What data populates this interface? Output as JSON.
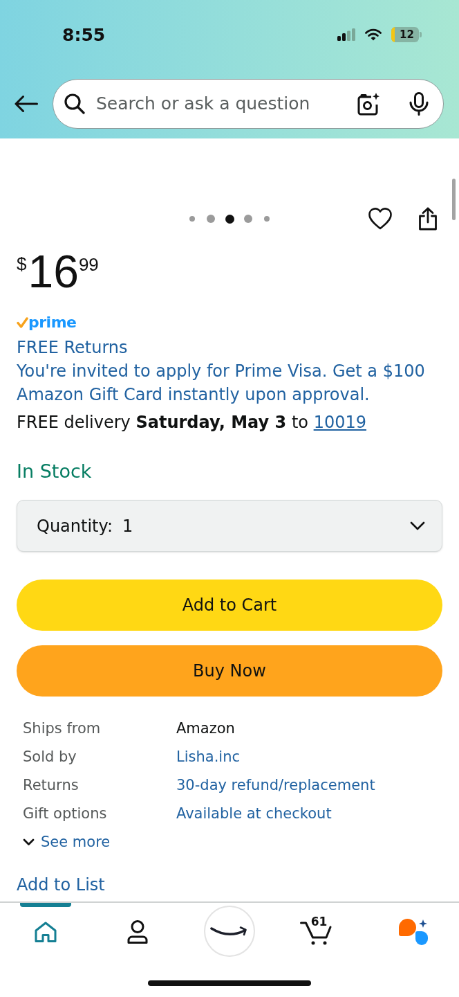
{
  "status_bar": {
    "time": "8:55",
    "battery": "12"
  },
  "search": {
    "placeholder": "Search or ask a question"
  },
  "carousel": {
    "dots": [
      {
        "selected": false
      },
      {
        "selected": false
      },
      {
        "selected": true
      },
      {
        "selected": false
      },
      {
        "selected": false
      }
    ]
  },
  "price": {
    "currency": "$",
    "whole": "16",
    "fraction": "99"
  },
  "prime": {
    "label": "prime"
  },
  "offers": [
    "FREE Returns",
    "You're invited to apply for Prime Visa. Get a $100 Amazon Gift Card instantly upon approval."
  ],
  "delivery": {
    "text": "FREE delivery **Saturday, May 3** to",
    "zip": "10019"
  },
  "availability": "In Stock",
  "quantity": {
    "label": "Quantity:",
    "value": "1"
  },
  "buttons": [
    {
      "label": "Add to Cart",
      "kind": "add_to_cart"
    },
    {
      "label": "Buy Now",
      "kind": "buy_now"
    }
  ],
  "details": [
    {
      "label": "Ships from",
      "value": "Amazon",
      "link": false
    },
    {
      "label": "Sold by",
      "value": "Lisha.inc",
      "link": true
    },
    {
      "label": "Returns",
      "value": "30-day refund/replacement",
      "link": true
    },
    {
      "label": "Gift options",
      "value": "Available at checkout",
      "link": true
    }
  ],
  "see_more": "See more",
  "add_to_list": "Add to List",
  "bottom_nav": {
    "items": [
      {
        "kind": "home",
        "selected": true
      },
      {
        "kind": "account",
        "selected": false
      },
      {
        "kind": "logo",
        "selected": false
      },
      {
        "kind": "cart",
        "selected": false,
        "count": "61"
      },
      {
        "kind": "assistant",
        "selected": false
      }
    ]
  }
}
